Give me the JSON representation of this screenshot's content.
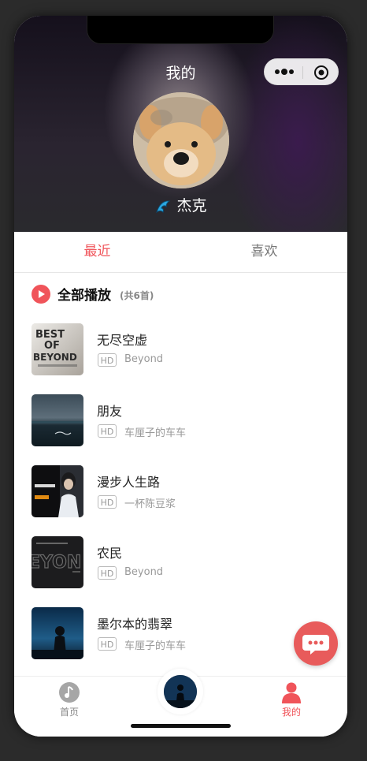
{
  "header": {
    "title": "我的",
    "user_name": "杰克"
  },
  "tabs": [
    {
      "label": "最近",
      "active": true
    },
    {
      "label": "喜欢",
      "active": false
    }
  ],
  "playall": {
    "label": "全部播放",
    "count": "(共6首)"
  },
  "songs": [
    {
      "title": "无尽空虚",
      "quality": "HD",
      "artist": "Beyond",
      "cover": "best-of-beyond-cover"
    },
    {
      "title": "朋友",
      "quality": "HD",
      "artist": "车厘子的车车",
      "cover": "pengyou-cover"
    },
    {
      "title": "漫步人生路",
      "quality": "HD",
      "artist": "一杯陈豆浆",
      "cover": "manbu-cover"
    },
    {
      "title": "农民",
      "quality": "HD",
      "artist": "Beyond",
      "cover": "beyond-cover"
    },
    {
      "title": "墨尔本的翡翠",
      "quality": "HD",
      "artist": "车厘子的车车",
      "cover": "melbourne-cover"
    }
  ],
  "tabbar": {
    "home_label": "首页",
    "mine_label": "我的"
  },
  "colors": {
    "accent": "#f0545a",
    "fab": "#e85b5b"
  }
}
